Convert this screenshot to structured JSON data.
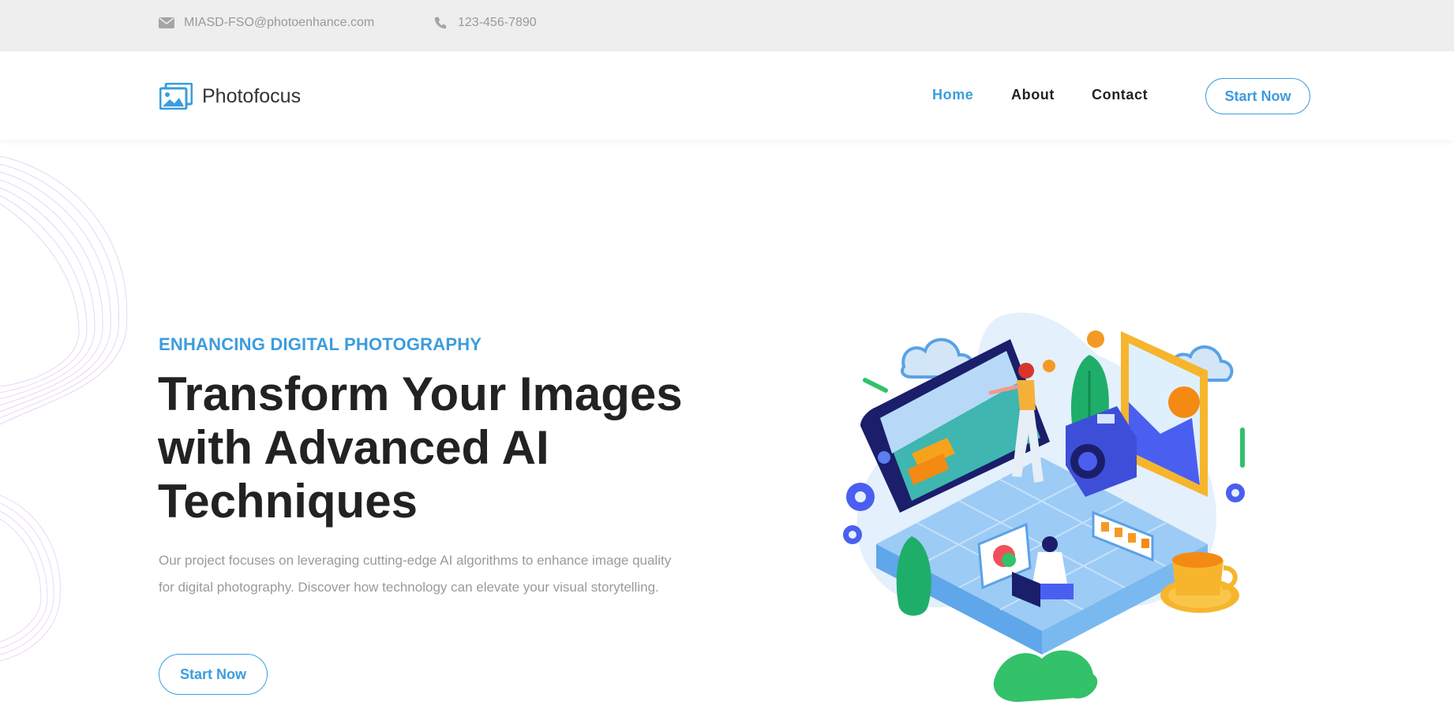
{
  "topbar": {
    "email": "MIASD-FSO@photoenhance.com",
    "phone": "123-456-7890"
  },
  "header": {
    "logo_text": "Photofocus",
    "nav": [
      {
        "label": "Home",
        "active": true
      },
      {
        "label": "About",
        "active": false
      },
      {
        "label": "Contact",
        "active": false
      }
    ],
    "cta_label": "Start Now"
  },
  "hero": {
    "eyebrow": "ENHANCING DIGITAL PHOTOGRAPHY",
    "title": "Transform Your Images with Advanced AI Techniques",
    "description": "Our project focuses on leveraging cutting-edge AI algorithms to enhance image quality for digital photography. Discover how technology can elevate your visual storytelling.",
    "cta_label": "Start Now"
  },
  "colors": {
    "accent": "#3b9ddd",
    "topbar_bg": "#eeeeee",
    "heading": "#222222",
    "muted_text": "#9a9a9a"
  },
  "icons": {
    "email": "envelope-icon",
    "phone": "phone-icon",
    "logo": "photo-frame-icon"
  }
}
